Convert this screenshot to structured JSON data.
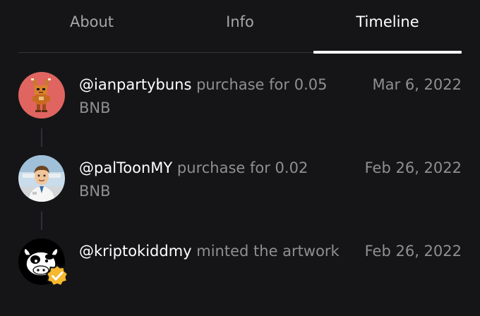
{
  "tabs": [
    {
      "label": "About",
      "active": false
    },
    {
      "label": "Info",
      "active": false
    },
    {
      "label": "Timeline",
      "active": true
    }
  ],
  "timeline": [
    {
      "username": "@ianpartybuns",
      "action": " purchase for 0.05 BNB",
      "date": "Mar 6, 2022",
      "avatar_color": "#e06561",
      "verified": false
    },
    {
      "username": "@palToonMY",
      "action": " purchase for 0.02 BNB",
      "date": "Feb 26, 2022",
      "avatar_color": "#9fc0d8",
      "verified": false
    },
    {
      "username": "@kriptokiddmy",
      "action": " minted the artwork",
      "date": "Feb 26, 2022",
      "avatar_color": "#000000",
      "verified": true
    }
  ],
  "colors": {
    "background": "#151517",
    "text_primary": "#ffffff",
    "text_secondary": "#8f8f8f",
    "verified_badge": "#f5b82e"
  }
}
